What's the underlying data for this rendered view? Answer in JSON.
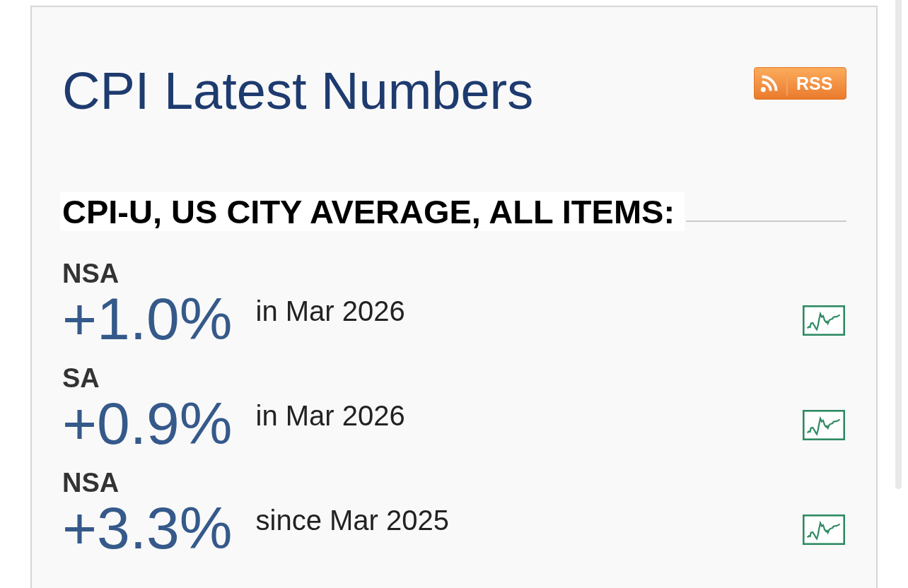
{
  "panel": {
    "title": "CPI Latest Numbers",
    "feed_badge": {
      "label": "RSS"
    },
    "series_heading": "CPI-U, US CITY AVERAGE, ALL ITEMS:",
    "figures": [
      {
        "adjustment": "NSA",
        "change": "+1.0%",
        "period": "in Mar 2026"
      },
      {
        "adjustment": "SA",
        "change": "+0.9%",
        "period": "in Mar 2026"
      },
      {
        "adjustment": "NSA",
        "change": "+3.3%",
        "period": "since Mar 2025"
      }
    ]
  }
}
